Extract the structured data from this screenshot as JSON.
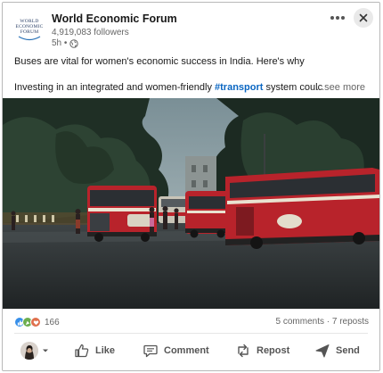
{
  "post": {
    "author": "World Economic Forum",
    "followers": "4,919,083 followers",
    "time": "5h •",
    "logo_text": [
      "WORLD",
      "ECONOMIC",
      "FORUM"
    ],
    "line1": "Buses are vital for women's economic success in India. Here's why",
    "line2_before": "Investing in an integrated and women-friendly ",
    "hashtag": "#transport",
    "line2_after": " system coulc",
    "see_more": "...see more"
  },
  "social": {
    "reaction_count": "166",
    "counts": "5 comments · 7 reposts",
    "reaction_icons": [
      "like-icon",
      "celebrate-icon",
      "support-icon"
    ],
    "reaction_colors": [
      "#378fe9",
      "#6dae4f",
      "#df704d"
    ]
  },
  "actions": {
    "like": "Like",
    "comment": "Comment",
    "repost": "Repost",
    "send": "Send"
  },
  "colors": {
    "accent": "#0a66c2",
    "bus_red": "#b8232b"
  }
}
